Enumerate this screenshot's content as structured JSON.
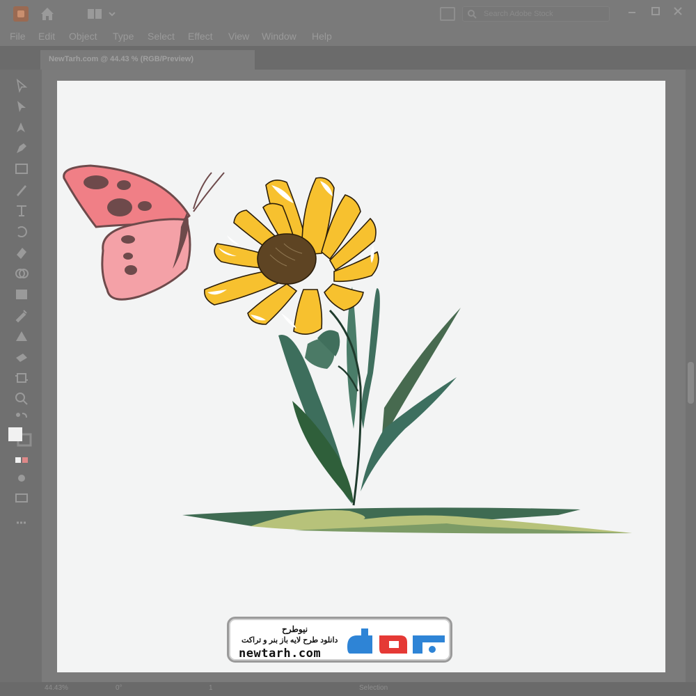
{
  "app": {
    "search_placeholder": "Search Adobe Stock",
    "document_tab": "NewTarh.com @ 44.43 % (RGB/Preview)"
  },
  "menu": [
    "File",
    "Edit",
    "Object",
    "Type",
    "Select",
    "Effect",
    "View",
    "Window",
    "Help"
  ],
  "status": {
    "zoom": "44.43%",
    "rotation": "0°",
    "artboard": "1",
    "tool": "Selection"
  },
  "watermark": {
    "brand_fa": "نیوطرح",
    "tagline_fa": "دانلود طرح لایه باز بنر و تراکت",
    "url": "newtarh.com"
  },
  "colors": {
    "petal": "#f7c12f",
    "petal_outline": "#2a1d0a",
    "flower_center": "#5e4423",
    "leaf": "#3f6f5e",
    "leaf_dark": "#2f5a48",
    "grass": "#3f6b52",
    "grass_light": "#b7c27a",
    "butterfly": "#f07f86",
    "butterfly_outline": "#6e4a4b"
  }
}
